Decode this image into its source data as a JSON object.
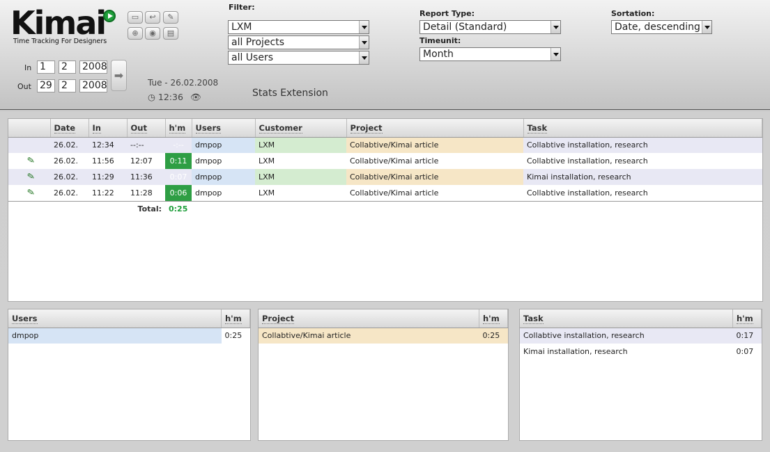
{
  "app": {
    "logo": "Kimai",
    "tagline": "Time Tracking For Designers"
  },
  "toolbar_icons": [
    "window-icon",
    "back-icon",
    "wrench-icon",
    "download-icon",
    "record-icon",
    "print-icon"
  ],
  "period": {
    "in_label": "In",
    "in_day": "1",
    "in_month": "2",
    "in_year": "2008",
    "out_label": "Out",
    "out_day": "29",
    "out_month": "2",
    "out_year": "2008",
    "go_icon": "arrow-right-icon"
  },
  "today": {
    "date": "Tue - 26.02.2008",
    "time": "12:36"
  },
  "extension_title": "Stats Extension",
  "filter": {
    "label": "Filter:",
    "customer": "LXM",
    "project": "all Projects",
    "user": "all Users"
  },
  "report": {
    "type_label": "Report Type:",
    "type_value": "Detail (Standard)",
    "timeunit_label": "Timeunit:",
    "timeunit_value": "Month"
  },
  "sortation": {
    "label": "Sortation:",
    "value": "Date, descending"
  },
  "main_table": {
    "headers": [
      "",
      "Date",
      "In",
      "Out",
      "h'm",
      "Users",
      "Customer",
      "Project",
      "Task"
    ],
    "rows": [
      {
        "date": "26.02.",
        "in": "12:34",
        "out": "--:--",
        "hm": "-:--",
        "user": "dmpop",
        "customer": "LXM",
        "project": "Collabtive/Kimai article",
        "task": "Collabtive installation, research",
        "editable": false
      },
      {
        "date": "26.02.",
        "in": "11:56",
        "out": "12:07",
        "hm": "0:11",
        "user": "dmpop",
        "customer": "LXM",
        "project": "Collabtive/Kimai article",
        "task": "Collabtive installation, research",
        "editable": true
      },
      {
        "date": "26.02.",
        "in": "11:29",
        "out": "11:36",
        "hm": "0:07",
        "user": "dmpop",
        "customer": "LXM",
        "project": "Collabtive/Kimai article",
        "task": "Kimai installation, research",
        "editable": true
      },
      {
        "date": "26.02.",
        "in": "11:22",
        "out": "11:28",
        "hm": "0:06",
        "user": "dmpop",
        "customer": "LXM",
        "project": "Collabtive/Kimai article",
        "task": "Collabtive installation, research",
        "editable": true
      }
    ],
    "total_label": "Total:",
    "total_value": "0:25"
  },
  "users_panel": {
    "header": "Users",
    "hm_header": "h'm",
    "rows": [
      {
        "name": "dmpop",
        "hm": "0:25"
      }
    ]
  },
  "project_panel": {
    "header": "Project",
    "hm_header": "h'm",
    "rows": [
      {
        "name": "Collabtive/Kimai article",
        "hm": "0:25"
      }
    ]
  },
  "task_panel": {
    "header": "Task",
    "hm_header": "h'm",
    "rows": [
      {
        "name": "Collabtive installation, research",
        "hm": "0:17"
      },
      {
        "name": "Kimai installation, research",
        "hm": "0:07"
      }
    ]
  }
}
